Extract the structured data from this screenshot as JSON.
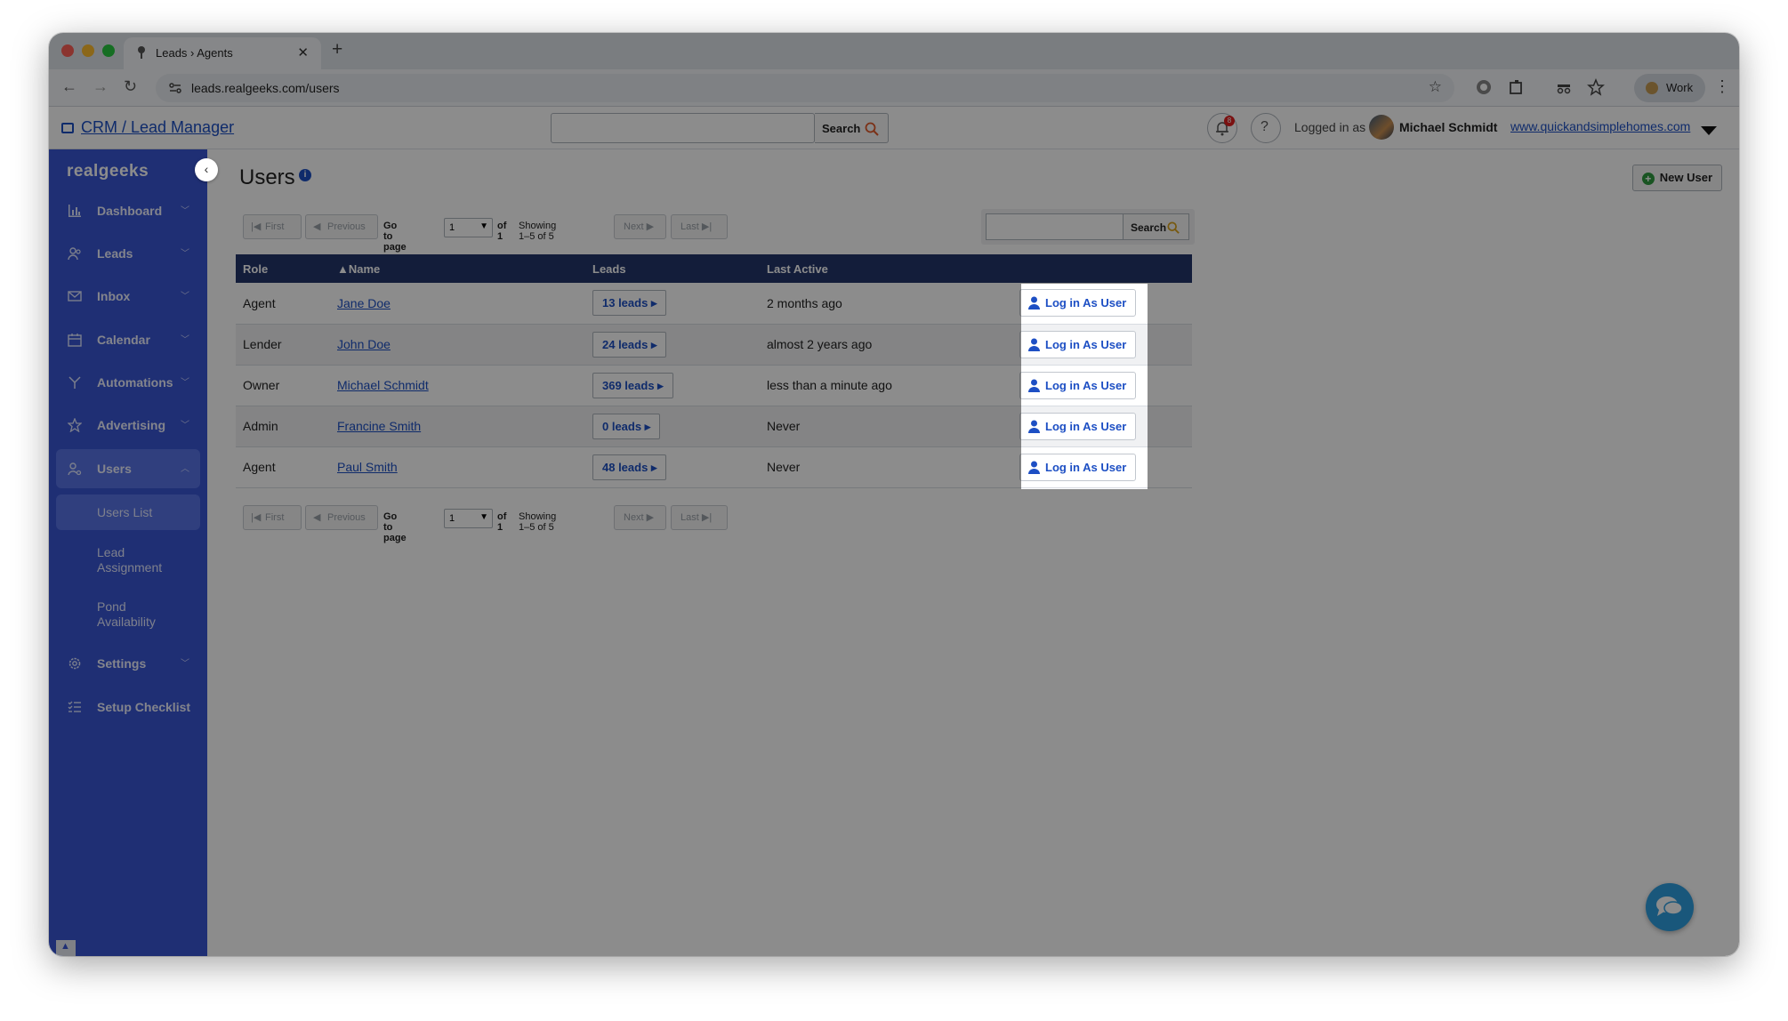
{
  "browser": {
    "tab_title": "Leads › Agents",
    "url": "leads.realgeeks.com/users",
    "profile_label": "Work"
  },
  "header": {
    "crm_link": "CRM / Lead Manager",
    "search_label": "Search",
    "notification_count": "8",
    "logged_in_label": "Logged in as",
    "user_name": "Michael Schmidt",
    "site_link": "www.quickandsimplehomes.com"
  },
  "sidebar": {
    "brand": "realgeeks",
    "items": [
      {
        "label": "Dashboard",
        "icon": "bar-chart-icon"
      },
      {
        "label": "Leads",
        "icon": "people-icon"
      },
      {
        "label": "Inbox",
        "icon": "mail-icon"
      },
      {
        "label": "Calendar",
        "icon": "calendar-icon"
      },
      {
        "label": "Automations",
        "icon": "branch-icon"
      },
      {
        "label": "Advertising",
        "icon": "star-icon"
      },
      {
        "label": "Users",
        "icon": "user-gear-icon"
      }
    ],
    "subitems": [
      {
        "label": "Users List"
      },
      {
        "label": "Lead Assignment"
      },
      {
        "label": "Pond Availability"
      }
    ],
    "bottom_items": [
      {
        "label": "Settings",
        "icon": "gear-icon"
      },
      {
        "label": "Setup Checklist",
        "icon": "checklist-icon"
      }
    ]
  },
  "main": {
    "title": "Users",
    "new_user_label": "New User",
    "pager": {
      "first": "First",
      "previous": "Previous",
      "go_to_page": "Go to page",
      "page_value": "1",
      "of_label": "of",
      "total_pages": "1",
      "showing": "Showing 1–5 of 5",
      "next": "Next",
      "last": "Last"
    },
    "search_label": "Search",
    "table": {
      "headers": [
        "Role",
        "▲Name",
        "Leads",
        "Last Active",
        ""
      ],
      "rows": [
        {
          "role": "Agent",
          "name": "Jane Doe",
          "leads": "13 leads",
          "last_active": "2 months ago",
          "action": "Log in As User"
        },
        {
          "role": "Lender",
          "name": "John Doe",
          "leads": "24 leads",
          "last_active": "almost 2 years ago",
          "action": "Log in As User"
        },
        {
          "role": "Owner",
          "name": "Michael Schmidt",
          "leads": "369 leads",
          "last_active": "less than a minute ago",
          "action": "Log in As User"
        },
        {
          "role": "Admin",
          "name": "Francine Smith",
          "leads": "0 leads",
          "last_active": "Never",
          "action": "Log in As User"
        },
        {
          "role": "Agent",
          "name": "Paul Smith",
          "leads": "48 leads",
          "last_active": "Never",
          "action": "Log in As User"
        }
      ]
    }
  }
}
